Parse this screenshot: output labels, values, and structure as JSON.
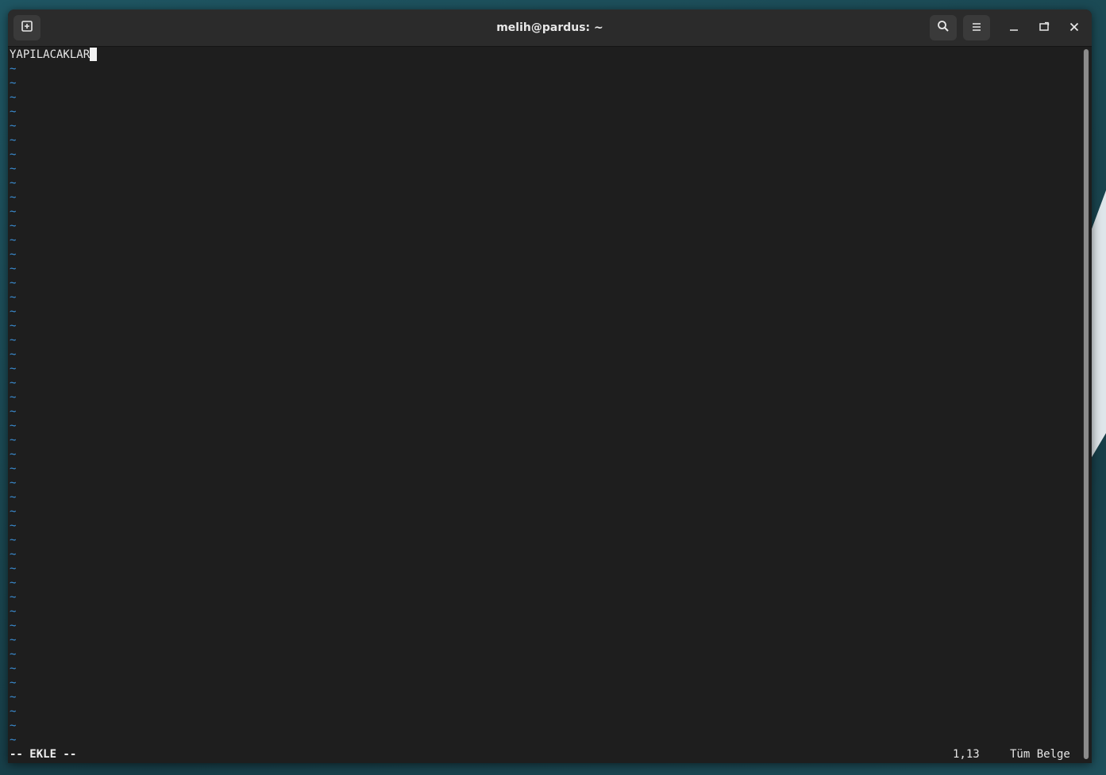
{
  "window": {
    "title": "melih@pardus: ~"
  },
  "toolbar": {
    "new_tab_icon": "new-tab-icon",
    "search_icon": "search-icon",
    "menu_icon": "hamburger-menu-icon",
    "minimize_icon": "minimize-icon",
    "maximize_icon": "maximize-icon",
    "close_icon": "close-icon"
  },
  "editor": {
    "first_line": "YAPILACAKLAR",
    "empty_line_marker": "~",
    "empty_line_count": 48,
    "colors": {
      "text": "#e6e6e6",
      "tilde": "#3b8fd6",
      "background": "#1e1e1e"
    }
  },
  "statusline": {
    "mode": "-- EKLE --",
    "position": "1,13",
    "scope": "Tüm Belge"
  }
}
